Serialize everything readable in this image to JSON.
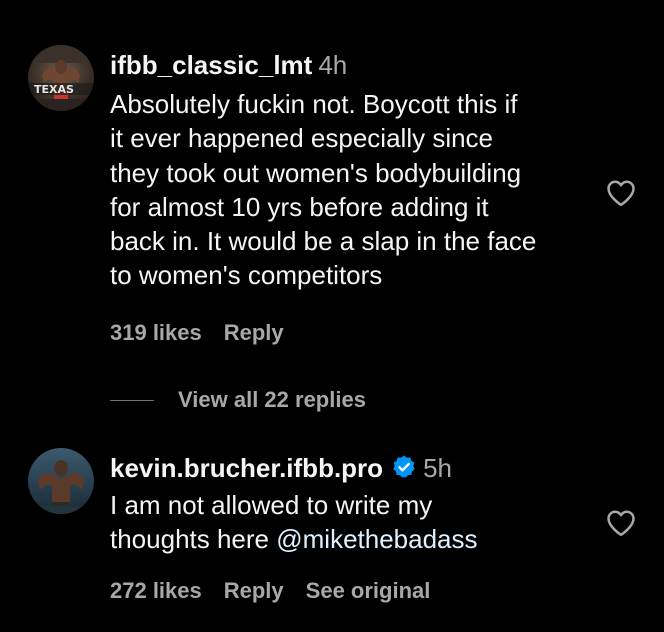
{
  "comments": [
    {
      "username": "ifbb_classic_lmt",
      "time": "4h",
      "verified": false,
      "lines": [
        "Absolutely fuckin not. Boycott this if",
        "it ever happened especially since",
        "they took out women's bodybuilding",
        "for almost 10 yrs before adding it",
        "back in. It would be a slap in the face",
        "to women's competitors"
      ],
      "likes": "319 likes",
      "reply_label": "Reply",
      "like_icon": "heart-outline-icon",
      "avatar_overlay_text": "TEXAS"
    },
    {
      "username": "kevin.brucher.ifbb.pro",
      "time": "5h",
      "verified": true,
      "verified_color": "#0095f6",
      "lines": [
        "I am not allowed to write my",
        "thoughts here "
      ],
      "mention": "@mikethebadass",
      "likes": "272 likes",
      "reply_label": "Reply",
      "see_original_label": "See original",
      "like_icon": "heart-outline-icon"
    }
  ],
  "view_replies": {
    "label": "View all 22 replies"
  },
  "colors": {
    "background": "#000000",
    "primary_text": "#f5f5f5",
    "secondary_text": "#a8a8a8",
    "verified_blue": "#0095f6"
  }
}
